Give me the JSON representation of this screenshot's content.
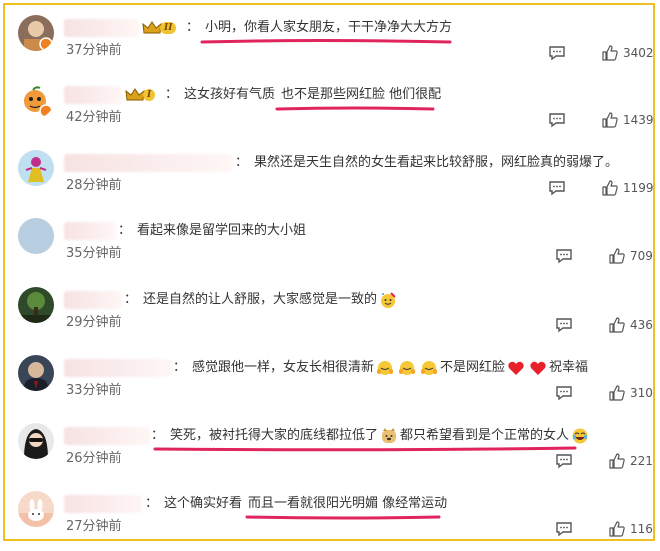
{
  "comments": [
    {
      "text_a": "小明，你看人家女朋友，干干净净大大方方",
      "time": "37分钟前",
      "likes": "3402",
      "level": "II"
    },
    {
      "text_a": "这女孩好有气质",
      "text_b": "也不是那些网红脸 他们很配",
      "time": "42分钟前",
      "likes": "1439",
      "level": "I"
    },
    {
      "text_a": "果然还是天生自然的女生看起来比较舒服，网红脸真的弱爆了。",
      "time": "28分钟前",
      "likes": "1199"
    },
    {
      "text_a": "看起来像是留学回来的大小姐",
      "time": "35分钟前",
      "likes": "709"
    },
    {
      "text_a": "还是自然的让人舒服，大家感觉是一致的",
      "time": "29分钟前",
      "likes": "436"
    },
    {
      "text_a": "感觉跟他一样，女友长相很清新",
      "text_b": "不是网红脸",
      "text_c": "祝幸福",
      "time": "33分钟前",
      "likes": "310"
    },
    {
      "text_a": "笑死，被衬托得大家的底线都拉低了",
      "text_b": "都只希望看到是个正常的女人",
      "time": "26分钟前",
      "likes": "221"
    },
    {
      "text_a": "这个确实好看",
      "text_b": "而且一看就很阳光明媚 像经常运动",
      "time": "27分钟前",
      "likes": "116"
    }
  ],
  "colon": "：",
  "colors": {
    "underline": "#e0245e",
    "frame": "#f0c020",
    "heart": "#e8202a"
  }
}
